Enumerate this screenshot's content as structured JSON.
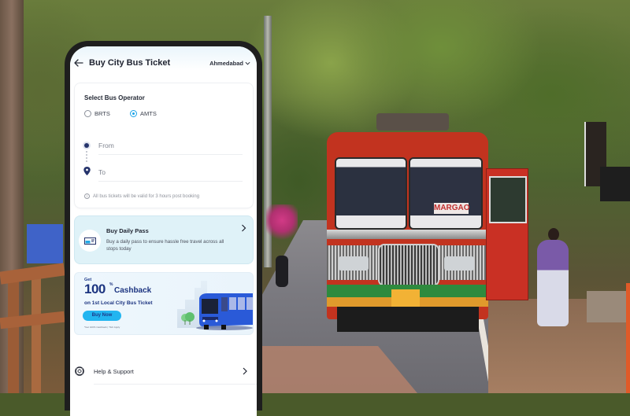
{
  "header": {
    "title": "Buy City Bus Ticket",
    "city": "Ahmedabad"
  },
  "operator": {
    "label": "Select Bus Operator",
    "options": [
      {
        "label": "BRTS",
        "selected": false
      },
      {
        "label": "AMTS",
        "selected": true
      }
    ]
  },
  "route": {
    "from_placeholder": "From",
    "to_placeholder": "To",
    "note": "All bus tickets will be valid for 3 hours post booking"
  },
  "daily_pass": {
    "title": "Buy Daily Pass",
    "description": "Buy a daily pass to ensure hassle free travel across all stops today"
  },
  "promo": {
    "get": "Get",
    "amount": "100",
    "percent": "%",
    "cashback": "Cashback",
    "subtitle": "on 1st Local City Bus Ticket",
    "button": "Buy Now",
    "terms": "*Get 100% Cashback | T&C Apply"
  },
  "help": {
    "label": "Help & Support"
  },
  "background": {
    "bus_destination_sign": "MARGAO"
  },
  "colors": {
    "accent": "#1aa3e8",
    "navy": "#1c3480",
    "pass_bg": "#dff2f8",
    "bus_red": "#c2331f"
  }
}
